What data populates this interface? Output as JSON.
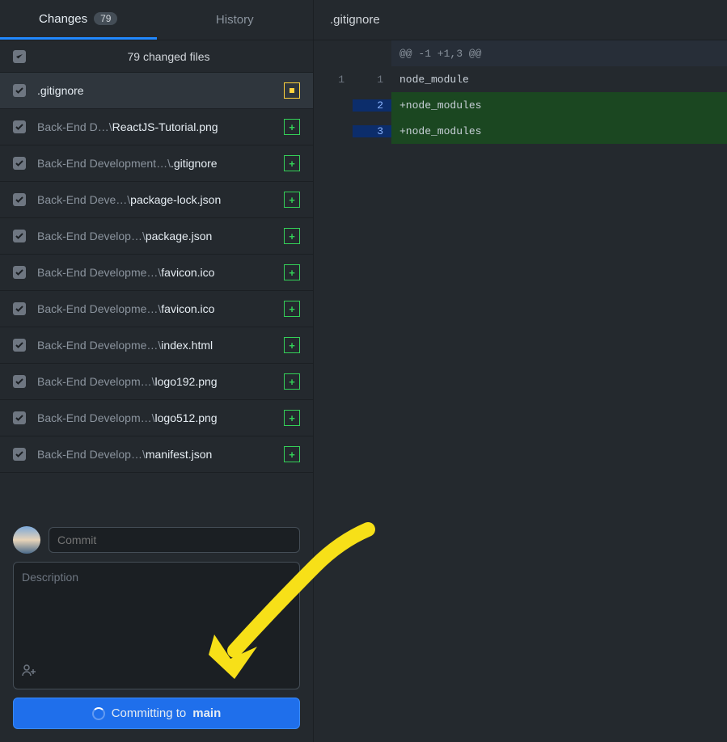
{
  "tabs": {
    "changes_label": "Changes",
    "changes_badge": "79",
    "history_label": "History"
  },
  "header": {
    "text": "79 changed files"
  },
  "files": [
    {
      "prefix": "",
      "name": ".gitignore",
      "status": "modified",
      "selected": true
    },
    {
      "prefix": "Back-End D…\\",
      "name": "ReactJS-Tutorial.png",
      "status": "added",
      "selected": false
    },
    {
      "prefix": "Back-End Development…\\",
      "name": ".gitignore",
      "status": "added",
      "selected": false
    },
    {
      "prefix": "Back-End Deve…\\",
      "name": "package-lock.json",
      "status": "added",
      "selected": false
    },
    {
      "prefix": "Back-End Develop…\\",
      "name": "package.json",
      "status": "added",
      "selected": false
    },
    {
      "prefix": "Back-End Developme…\\",
      "name": "favicon.ico",
      "status": "added",
      "selected": false
    },
    {
      "prefix": "Back-End Developme…\\",
      "name": "favicon.ico",
      "status": "added",
      "selected": false
    },
    {
      "prefix": "Back-End Developme…\\",
      "name": "index.html",
      "status": "added",
      "selected": false
    },
    {
      "prefix": "Back-End Developm…\\",
      "name": "logo192.png",
      "status": "added",
      "selected": false
    },
    {
      "prefix": "Back-End Developm…\\",
      "name": "logo512.png",
      "status": "added",
      "selected": false
    },
    {
      "prefix": "Back-End Develop…\\",
      "name": "manifest.json",
      "status": "added",
      "selected": false
    }
  ],
  "commit": {
    "summary_placeholder": "Commit",
    "description_placeholder": "Description",
    "button_prefix": "Committing to ",
    "button_branch": "main"
  },
  "diff": {
    "filename": ".gitignore",
    "hunk": "@@ -1 +1,3 @@",
    "lines": [
      {
        "old": "1",
        "new": "1",
        "type": "ctx",
        "text": " node_module"
      },
      {
        "old": "",
        "new": "2",
        "type": "add",
        "text": "+node_modules"
      },
      {
        "old": "",
        "new": "3",
        "type": "add",
        "text": "+node_modules"
      }
    ]
  }
}
